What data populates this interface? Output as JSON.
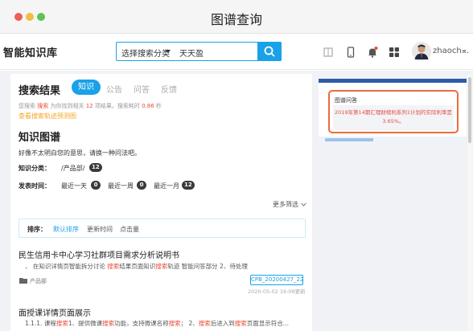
{
  "window": {
    "title": "图谱查询"
  },
  "header": {
    "logo": "智能知识库",
    "search_category": "选择搜索分类",
    "search_value": "天天盈",
    "username": "zhaoch..."
  },
  "results": {
    "title": "搜索结果",
    "tabs": [
      "知识",
      "公告",
      "问答",
      "反馈"
    ],
    "summary_prefix": "您搜索",
    "summary_keyword": "搜索",
    "summary_mid": "为你找到相关",
    "summary_count": "12",
    "summary_mid2": "项结果。搜索耗时",
    "summary_time": "0.86",
    "summary_unit": "秒",
    "track_link": "查看搜索轨迹预测图"
  },
  "knowledge_graph": {
    "title": "知识图谱",
    "sorry_text": "好像不太明白您的意思，请换一种问法吧。",
    "category_label": "知识分类：",
    "category_value": "/产品部/",
    "category_count": "12",
    "time_label": "发表时间：",
    "time_options": [
      {
        "label": "最近一天",
        "count": "0"
      },
      {
        "label": "最近一周",
        "count": "0"
      },
      {
        "label": "最近一月",
        "count": "12"
      }
    ],
    "more_filter": "更多筛选"
  },
  "sort": {
    "label": "排序：",
    "options": [
      "默认排序",
      "更新时间",
      "点击量"
    ]
  },
  "result_items": [
    {
      "title": "民生信用卡中心学习社群项目需求分析说明书",
      "snippet_parts": [
        "、 在知识详情页智能拆分讨论 ",
        "搜索",
        "结果页面知识",
        "搜索",
        "轨迹 智能问答部分 2、待处理"
      ],
      "folder": "产品部",
      "tag": "CPB_20200427_22",
      "date": "2020-05-02 16:08更新"
    },
    {
      "title": "面授课详情页面展示",
      "snippet_parts": [
        "1.1.1. 课程",
        "搜索",
        "1、提供微课",
        "搜索",
        "功能，支持微课名称",
        "搜索",
        "； 2、",
        "搜索",
        "后进入到",
        "搜索",
        "页面显示符合..."
      ]
    }
  ],
  "qa_panel": {
    "title": "图谱问答",
    "answer_line1": "2019年第14期汇理财榜利系列1计划的实际利率是",
    "answer_line2": "3.65%。"
  },
  "colors": {
    "accent": "#1aa1e8",
    "keyword": "#e84a3c",
    "link_orange": "#f5a623",
    "qa_border": "#ef6a3a"
  }
}
